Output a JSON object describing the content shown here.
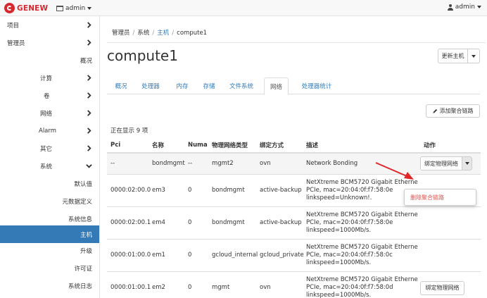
{
  "topbar": {
    "brand": "GENEW",
    "project_label": "admin",
    "user_label": "admin"
  },
  "sidebar": {
    "items": [
      {
        "label": "项目",
        "chevron": "right"
      },
      {
        "label": "管理员",
        "chevron": "right"
      },
      {
        "label": "概况"
      },
      {
        "label": "计算",
        "chevron": "right"
      },
      {
        "label": "卷",
        "chevron": "right"
      },
      {
        "label": "网络",
        "chevron": "right"
      },
      {
        "label": "Alarm",
        "chevron": "right"
      },
      {
        "label": "其它",
        "chevron": "right"
      },
      {
        "label": "系统",
        "chevron": "down"
      },
      {
        "label": "默认值"
      },
      {
        "label": "元数据定义"
      },
      {
        "label": "系统信息"
      },
      {
        "label": "主机",
        "active": true
      },
      {
        "label": "升级"
      },
      {
        "label": "许可证"
      },
      {
        "label": "系统日志"
      }
    ]
  },
  "breadcrumb": {
    "items": [
      "管理员",
      "系统",
      "主机",
      "compute1"
    ]
  },
  "page": {
    "title": "compute1",
    "update_host_label": "更新主机"
  },
  "tabs": [
    {
      "label": "概况"
    },
    {
      "label": "处理器"
    },
    {
      "label": "内存"
    },
    {
      "label": "存储"
    },
    {
      "label": "文件系统"
    },
    {
      "label": "网络",
      "active": true
    },
    {
      "label": "处理器统计"
    }
  ],
  "actions": {
    "add_aggregate_label": "添加聚合链路"
  },
  "table": {
    "showing_text": "正在显示 9 项",
    "columns": [
      "Pci",
      "名称",
      "Numa",
      "物理网络类型",
      "绑定方式",
      "描述",
      "动作"
    ],
    "rows": [
      {
        "pci": "--",
        "name": "bondmgmt",
        "numa": "--",
        "net_type": "mgmt2",
        "bind": "ovn",
        "desc": [
          "Network Bonding"
        ],
        "action": "绑定物理网络",
        "action_dropdown": true
      },
      {
        "pci": "0000:02:00.0",
        "name": "em3",
        "numa": "0",
        "net_type": "bondmgmt",
        "bind": "active-backup",
        "desc": [
          "NetXtreme BCM5720 Gigabit Etherne",
          "PCIe, mac=20:04:0f:f7:58:0e",
          "linkspeed=Unknown!."
        ]
      },
      {
        "pci": "0000:02:00.1",
        "name": "em4",
        "numa": "0",
        "net_type": "bondmgmt",
        "bind": "active-backup",
        "desc": [
          "NetXtreme BCM5720 Gigabit Etherne",
          "PCIe, mac=20:04:0f:f7:58:0e",
          "linkspeed=1000Mb/s."
        ]
      },
      {
        "pci": "0000:01:00.0",
        "name": "em1",
        "numa": "0",
        "net_type": "gcloud_internal",
        "bind": "gcloud_private",
        "desc": [
          "NetXtreme BCM5720 Gigabit Etherne",
          "PCIe, mac=20:04:0f:f7:58:0c",
          "linkspeed=1000Mb/s."
        ]
      },
      {
        "pci": "0000:01:00.1",
        "name": "em2",
        "numa": "0",
        "net_type": "mgmt",
        "bind": "ovn",
        "desc": [
          "NetXtreme BCM5720 Gigabit Etherne",
          "PCIe, mac=20:04:0f:f7:58:0d",
          "linkspeed=1000Mb/s."
        ],
        "action": "绑定物理网络"
      }
    ]
  },
  "dropdown": {
    "delete_label": "删除聚合链路"
  },
  "colors": {
    "brand_red": "#d7282f",
    "link_blue": "#337ab7",
    "active_nav": "#337ab7",
    "danger": "#d9534f",
    "annotation_arrow": "#e0262b"
  }
}
